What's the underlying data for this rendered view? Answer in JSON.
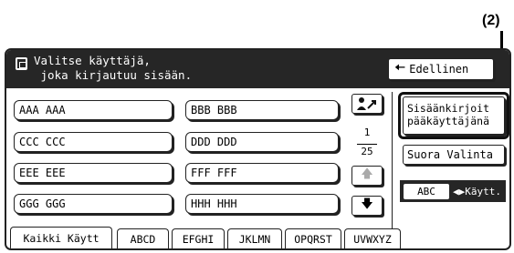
{
  "callout": {
    "label": "(2)"
  },
  "header": {
    "title": "Valitse käyttäjä,\n joka kirjautuu sisään.",
    "back_label": "Edellinen"
  },
  "users": [
    "AAA AAA",
    "BBB BBB",
    "CCC CCC",
    "DDD DDD",
    "EEE EEE",
    "FFF FFF",
    "GGG GGG",
    "HHH HHH"
  ],
  "pager": {
    "current": "1",
    "total": "25"
  },
  "side": {
    "admin_login_label": "Sisäänkirjoit\npääkäyttäjänä",
    "direct_select_label": "Suora Valinta"
  },
  "tabs": [
    "Kaikki Käytt",
    "ABCD",
    "EFGHI",
    "JKLMN",
    "OPQRST",
    "UVWXYZ"
  ],
  "toggle": {
    "abc_label": "ABC",
    "kayt_label": "Käytt."
  },
  "icons": {
    "header": "user-select-icon",
    "back": "back-arrow-icon",
    "swap": "user-swap-icon",
    "up": "scroll-up-icon",
    "down": "scroll-down-icon",
    "toggle": "left-right-arrow-icon"
  },
  "colors": {
    "header_bg": "#262626",
    "text": "#000000",
    "panel_bg": "#ffffff"
  }
}
